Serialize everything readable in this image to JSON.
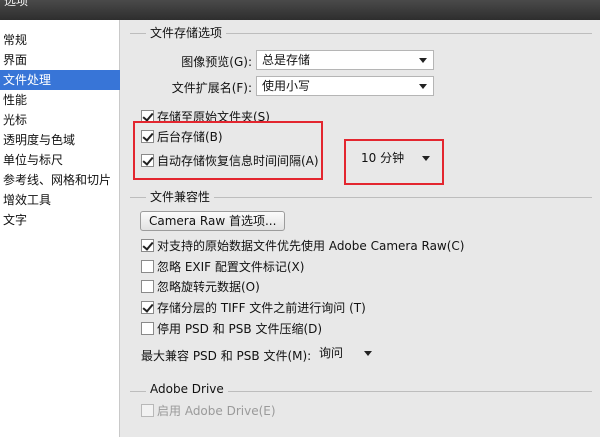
{
  "window": {
    "title": "选项"
  },
  "sidebar": {
    "items": [
      {
        "label": "常规"
      },
      {
        "label": "界面"
      },
      {
        "label": "文件处理",
        "selected": true
      },
      {
        "label": "性能"
      },
      {
        "label": "光标"
      },
      {
        "label": "透明度与色域"
      },
      {
        "label": "单位与标尺"
      },
      {
        "label": "参考线、网格和切片"
      },
      {
        "label": "增效工具"
      },
      {
        "label": "文字"
      }
    ]
  },
  "file_saving": {
    "title": "文件存储选项",
    "image_preview": {
      "label": "图像预览(G):",
      "value": "总是存储"
    },
    "file_extension": {
      "label": "文件扩展名(F):",
      "value": "使用小写"
    },
    "save_to_original_folder": {
      "label": "存储至原始文件夹(S)",
      "checked": true
    },
    "background_save": {
      "label": "后台存储(B)",
      "checked": true
    },
    "auto_save": {
      "label": "自动存储恢复信息时间间隔(A)",
      "checked": true,
      "interval": "10 分钟"
    }
  },
  "compatibility": {
    "title": "文件兼容性",
    "camera_raw_button": "Camera Raw 首选项...",
    "options": [
      {
        "label": "对支持的原始数据文件优先使用 Adobe Camera Raw(C)",
        "checked": true
      },
      {
        "label": "忽略 EXIF 配置文件标记(X)",
        "checked": false
      },
      {
        "label": "忽略旋转元数据(O)",
        "checked": false
      },
      {
        "label": "存储分层的 TIFF 文件之前进行询问 (T)",
        "checked": true
      },
      {
        "label": "停用 PSD 和 PSB 文件压缩(D)",
        "checked": false
      }
    ],
    "max_compat": {
      "label": "最大兼容 PSD 和 PSB 文件(M):",
      "value": "询问"
    }
  },
  "adobe_drive": {
    "title": "Adobe Drive",
    "enable": {
      "label": "启用 Adobe Drive(E)",
      "checked": false,
      "disabled": true
    }
  },
  "colors": {
    "selection": "#3875d7",
    "highlight_box": "#e3262f"
  }
}
